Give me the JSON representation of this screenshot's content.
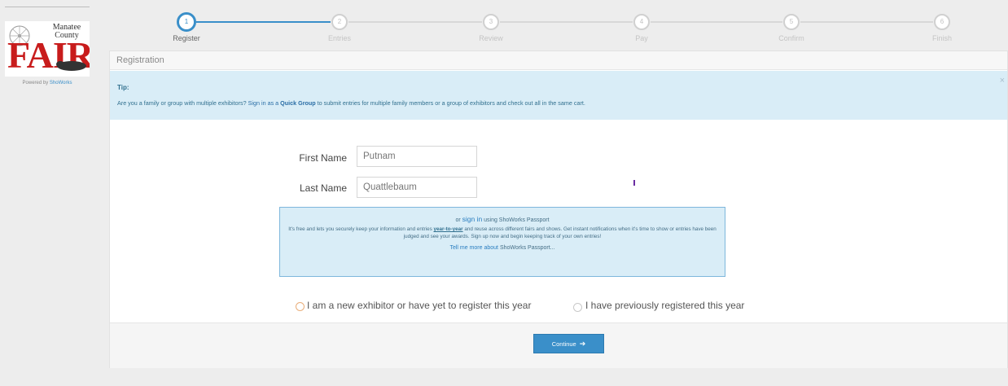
{
  "sidebar": {
    "logo_top": "Manatee County",
    "logo_word": "FAIR",
    "powered_prefix": "Powered by ",
    "powered_link": "ShoWorks"
  },
  "stepper": {
    "steps": [
      {
        "num": "1",
        "label": "Register"
      },
      {
        "num": "2",
        "label": "Entries"
      },
      {
        "num": "3",
        "label": "Review"
      },
      {
        "num": "4",
        "label": "Pay"
      },
      {
        "num": "5",
        "label": "Confirm"
      },
      {
        "num": "6",
        "label": "Finish"
      }
    ],
    "active_index": 0
  },
  "panel": {
    "title": "Registration"
  },
  "tip": {
    "title": "Tip:",
    "text_pre": "Are you a family or group with multiple exhibitors? ",
    "signin_link": "Sign in as a",
    "quick_group": "Quick Group",
    "text_post": " to submit entries for multiple family members or a group of exhibitors and check out all in the same cart.",
    "close": "×"
  },
  "form": {
    "first_name_label": "First Name",
    "first_name_value": "Putnam",
    "last_name_label": "Last Name",
    "last_name_value": "Quattlebaum"
  },
  "passport": {
    "or": "or ",
    "signin": "sign in",
    "using": " using ShoWorks Passport",
    "body_1": "It's free and lets you securely keep your information and entries ",
    "year_to_year": "year-to-year",
    "body_2": " and reuse across different fairs and shows. Get instant notifications when it's time to show or entries have been judged and see your awards. Sign up now and begin keeping track of your own entries!",
    "tell_more": "Tell me more about",
    "tell_more_suffix": " ShoWorks Passport..."
  },
  "options": {
    "new_exhibitor": "I am a new exhibitor or have yet to register this year",
    "previously_registered": "I have previously registered this year"
  },
  "actions": {
    "continue_label": "Continue"
  },
  "colors": {
    "accent": "#3a8fc9",
    "tip_bg": "#d9edf7",
    "fair_red": "#c81c1c"
  }
}
